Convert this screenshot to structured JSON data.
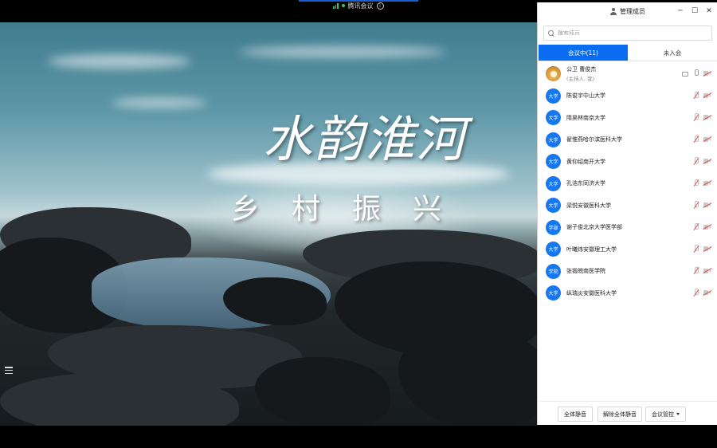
{
  "meeting": {
    "title": "腾讯会议",
    "info_icon": "info-icon"
  },
  "slide": {
    "title": "水韵淮河",
    "subtitle": "乡村振兴"
  },
  "panel": {
    "title": "管理成员",
    "search_placeholder": "搜索成员",
    "tabs": [
      {
        "label": "会议中(11)",
        "active": true
      },
      {
        "label": "未入会",
        "active": false
      }
    ],
    "host": {
      "name": "公卫  曹俊杰",
      "role": "(主持人, 我)"
    },
    "members": [
      {
        "avatar": "大学",
        "name": "陈俊宇中山大学"
      },
      {
        "avatar": "大学",
        "name": "隋昊林南京大学"
      },
      {
        "avatar": "大学",
        "name": "翟惟燕哈尔滨医科大学"
      },
      {
        "avatar": "大学",
        "name": "黄仰绍南开大学"
      },
      {
        "avatar": "大学",
        "name": "孔浩东同济大学"
      },
      {
        "avatar": "大学",
        "name": "梁悦安徽医科大学"
      },
      {
        "avatar": "学部",
        "name": "谢子俊北京大学医学部"
      },
      {
        "avatar": "大学",
        "name": "叶曦炜安徽理工大学"
      },
      {
        "avatar": "学院",
        "name": "张锻皖南医学院"
      },
      {
        "avatar": "大学",
        "name": "纵瑞炎安徽医科大学"
      }
    ],
    "footer": {
      "mute_all": "全体静音",
      "unmute_all": "解除全体静音",
      "control": "会议管控"
    }
  },
  "colors": {
    "accent": "#0a6cf0",
    "muted_red": "#e04848",
    "signal_green": "#3cc860"
  }
}
